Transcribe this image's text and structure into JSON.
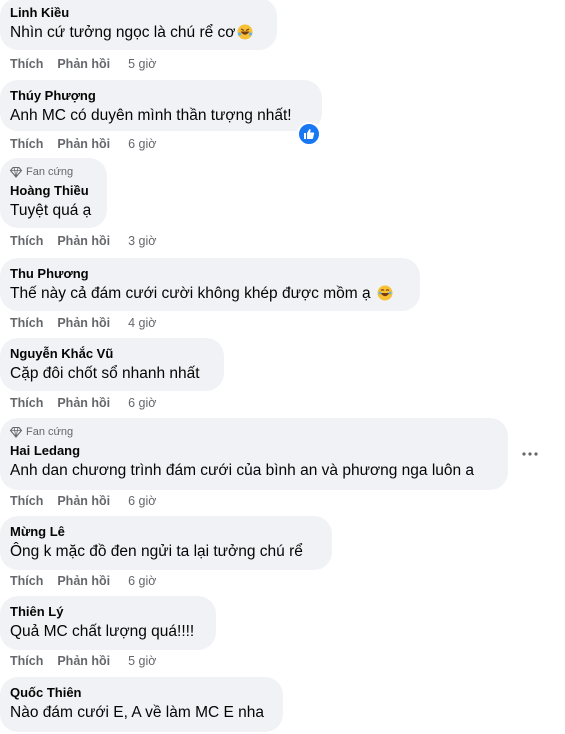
{
  "labels": {
    "like": "Thích",
    "reply": "Phản hồi",
    "fan_badge": "Fan cứng"
  },
  "comments": [
    {
      "author": "Linh Kiều",
      "text": "Nhìn cứ tưởng ngọc là chú rể cơ",
      "time": "5 giờ",
      "emoji": "rofl-emoji"
    },
    {
      "author": "Thúy Phượng",
      "text": "Anh MC có duyên mình thần tượng nhất!",
      "time": "6 giờ",
      "reaction": "like-icon"
    },
    {
      "author": "Hoàng Thiều",
      "text": "Tuyệt quá ạ",
      "time": "3 giờ",
      "badge": "Fan cứng"
    },
    {
      "author": "Thu Phương",
      "text": "Thế này cả đám cưới cười không khép được mồm ạ",
      "time": "4 giờ",
      "emoji": "laugh-emoji"
    },
    {
      "author": "Nguyễn Khắc Vũ",
      "text": "Cặp đôi chốt sổ nhanh nhất",
      "time": "6 giờ"
    },
    {
      "author": "Hai Ledang",
      "text": "Anh dan chương trình đám cưới của bình an và phương nga luôn a",
      "time": "6 giờ",
      "badge": "Fan cứng"
    },
    {
      "author": "Mừng Lê",
      "text": "Ông k mặc đồ đen ngửi ta lại tưởng chú rể",
      "time": "6 giờ"
    },
    {
      "author": "Thiên Lý",
      "text": "Quả MC chất lượng quá!!!!",
      "time": "5 giờ"
    },
    {
      "author": "Quốc Thiên",
      "text": "Nào đám cưới E, A về làm MC E nha"
    }
  ],
  "colors": {
    "bubble": "#f0f2f5",
    "meta": "#65676b",
    "like_blue": "#1877f2"
  }
}
